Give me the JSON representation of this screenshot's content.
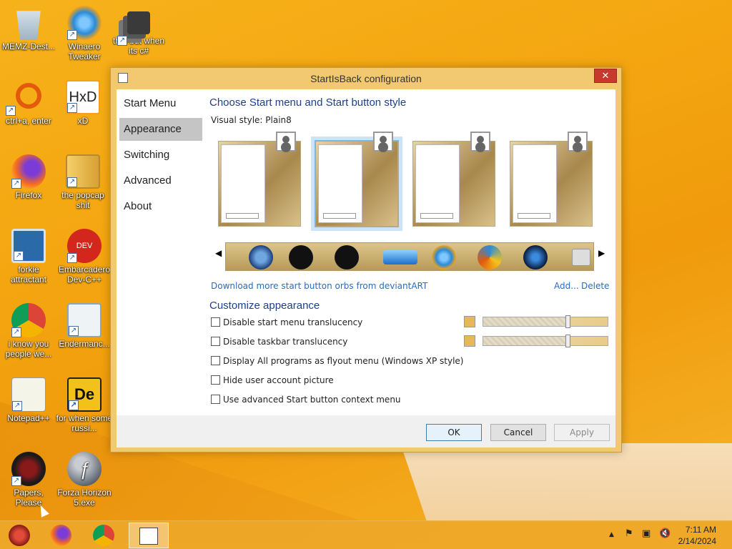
{
  "desktop": {
    "icons": [
      {
        "label": "MEMZ-Dest...",
        "icon": "recycle-bin-icon"
      },
      {
        "label": "Winaero Tweaker",
        "icon": "winaero-icon"
      },
      {
        "label": "that but when its c#",
        "icon": "stack-icon"
      },
      {
        "label": "ctrl+a, enter",
        "icon": "magnifier-icon"
      },
      {
        "label": "xD",
        "icon": "hxd-icon"
      },
      {
        "label": "Firefox",
        "icon": "firefox-icon"
      },
      {
        "label": "the popcap shit",
        "icon": "popcap-icon"
      },
      {
        "label": "forkie attractant",
        "icon": "gear-monitor-icon"
      },
      {
        "label": "Embarcadero Dev-C++",
        "icon": "devcpp-icon"
      },
      {
        "label": "i know you people we...",
        "icon": "chrome-icon"
      },
      {
        "label": "Endermanc...",
        "icon": "window-icon"
      },
      {
        "label": "Notepad++",
        "icon": "notepad-icon"
      },
      {
        "label": "for when some russi...",
        "icon": "de-icon"
      },
      {
        "label": "Papers, Please",
        "icon": "papers-please-icon"
      },
      {
        "label": "Forza Horizon 5.exe",
        "icon": "flash-icon"
      }
    ]
  },
  "window": {
    "title": "StartIsBack configuration",
    "close_label": "✕",
    "nav": [
      "Start Menu",
      "Appearance",
      "Switching",
      "Advanced",
      "About"
    ],
    "active_nav": "Appearance",
    "heading": "Choose Start menu and Start button style",
    "visual_style_label": "Visual style:",
    "visual_style_value": "Plain8",
    "download_link": "Download more start button orbs from deviantART",
    "add_link": "Add...",
    "delete_link": "Delete",
    "customize_heading": "Customize appearance",
    "options": [
      {
        "label": "Disable start menu translucency",
        "checked": false
      },
      {
        "label": "Disable taskbar translucency",
        "checked": false
      },
      {
        "label": "Display All programs as flyout menu (Windows XP style)",
        "checked": false
      },
      {
        "label": "Hide user account picture",
        "checked": false
      },
      {
        "label": "Use advanced Start button context menu",
        "checked": false
      }
    ],
    "sliders": [
      {
        "level": 0.68
      },
      {
        "level": 0.68
      }
    ],
    "buttons": {
      "ok": "OK",
      "cancel": "Cancel",
      "apply": "Apply"
    }
  },
  "taskbar": {
    "clock_time": "7:11 AM",
    "clock_date": "2/14/2024",
    "tray_up": "▲",
    "colors": {
      "bar": "#eea728"
    }
  }
}
